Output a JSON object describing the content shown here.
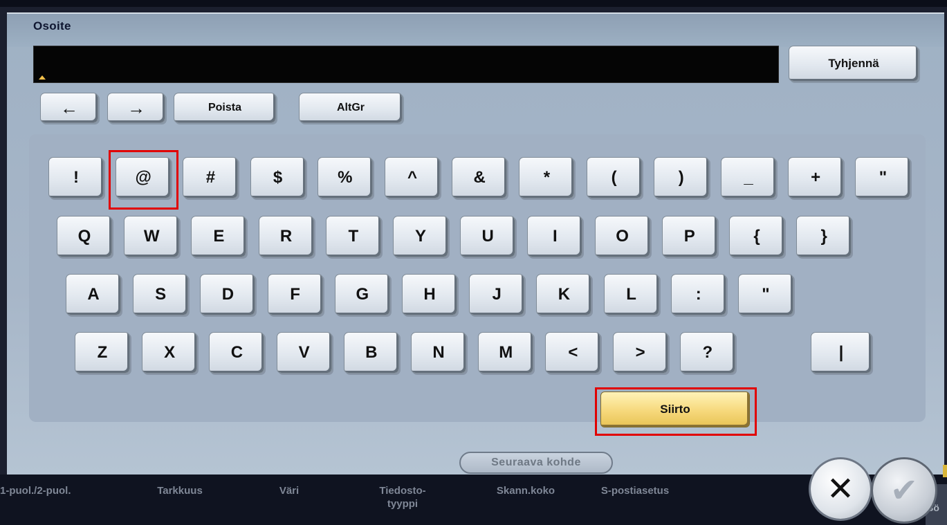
{
  "dialog": {
    "title": "Osoite"
  },
  "input": {
    "value": "",
    "clear_label": "Tyhjennä"
  },
  "nav": {
    "left": "←",
    "right": "→",
    "delete": "Poista",
    "altgr": "AltGr"
  },
  "keyboard": {
    "rows": [
      [
        "!",
        "@",
        "#",
        "$",
        "%",
        "^",
        "&",
        "*",
        "(",
        ")",
        "_",
        "+",
        "\""
      ],
      [
        "Q",
        "W",
        "E",
        "R",
        "T",
        "Y",
        "U",
        "I",
        "O",
        "P",
        "{",
        "}"
      ],
      [
        "A",
        "S",
        "D",
        "F",
        "G",
        "H",
        "J",
        "K",
        "L",
        ":",
        "\""
      ],
      [
        "Z",
        "X",
        "C",
        "V",
        "B",
        "N",
        "M",
        "<",
        ">",
        "?"
      ]
    ],
    "pipe_key": "|",
    "shift_label": "Siirto"
  },
  "next_destination": "Seuraava kohde",
  "bottom_tabs": [
    "1-puol./2-puol.",
    "Tarkkuus",
    "Väri",
    "Tiedosto-\ntyyppi",
    "Skann.koko",
    "S-postiasetus"
  ],
  "actions": {
    "cancel": "✕",
    "ok": "✔",
    "side_tab": "Sö"
  },
  "colors": {
    "highlight": "#e10000",
    "shift_key": "#f6d87b"
  }
}
